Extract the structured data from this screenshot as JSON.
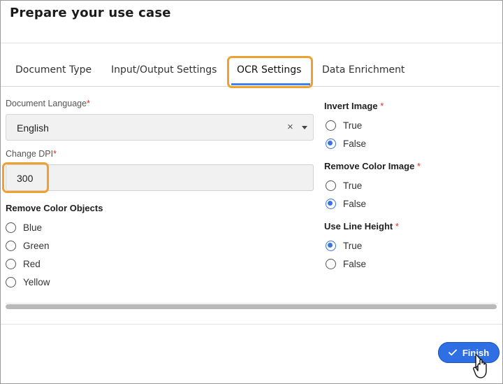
{
  "dialog": {
    "title": "Prepare your use case"
  },
  "tabs": [
    {
      "label": "Document Type"
    },
    {
      "label": "Input/Output Settings"
    },
    {
      "label": "OCR Settings",
      "active": true
    },
    {
      "label": "Data Enrichment"
    }
  ],
  "document_language": {
    "label": "Document Language",
    "required_mark": "*",
    "value": "English",
    "clear_glyph": "×"
  },
  "change_dpi": {
    "label": "Change DPI",
    "required_mark": "*",
    "value": "300"
  },
  "remove_color_objects": {
    "label": "Remove Color Objects",
    "options": [
      {
        "label": "Blue",
        "selected": false
      },
      {
        "label": "Green",
        "selected": false
      },
      {
        "label": "Red",
        "selected": false
      },
      {
        "label": "Yellow",
        "selected": false
      }
    ]
  },
  "invert_image": {
    "label": "Invert Image",
    "required_mark": "*",
    "options": [
      {
        "label": "True",
        "selected": false
      },
      {
        "label": "False",
        "selected": true
      }
    ]
  },
  "remove_color_image": {
    "label": "Remove Color Image",
    "required_mark": "*",
    "options": [
      {
        "label": "True",
        "selected": false
      },
      {
        "label": "False",
        "selected": true
      }
    ]
  },
  "use_line_height": {
    "label": "Use Line Height",
    "required_mark": "*",
    "options": [
      {
        "label": "True",
        "selected": true
      },
      {
        "label": "False",
        "selected": false
      }
    ]
  },
  "footer": {
    "finish_label": "Finish"
  },
  "colors": {
    "accent": "#2f6fe4",
    "highlight": "#f0a030",
    "required": "#d93025"
  },
  "icons": {
    "finish": "check-icon",
    "cursor": "mouse-pointer-icon",
    "dropdown": "chevron-down-icon"
  }
}
